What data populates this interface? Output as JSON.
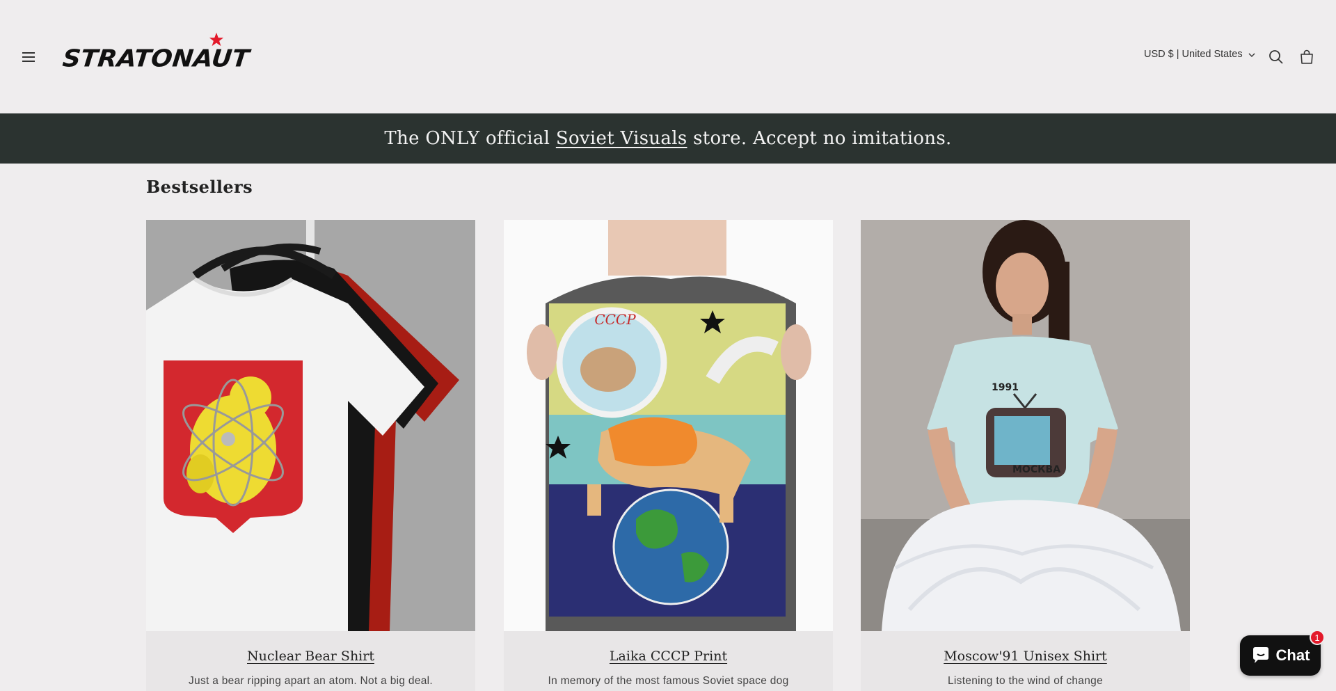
{
  "header": {
    "logo_text": "STRATONAUT",
    "currency": "USD $ | United States"
  },
  "announcement": {
    "prefix": "The ONLY official ",
    "link": "Soviet Visuals",
    "suffix": " store. Accept no imitations."
  },
  "section": {
    "title": "Bestsellers"
  },
  "products": [
    {
      "title": "Nuclear Bear Shirt",
      "description": "Just a bear ripping apart an atom. Not a big deal."
    },
    {
      "title": "Laika CCCP Print",
      "description": "In memory of the most famous Soviet space dog"
    },
    {
      "title": "Moscow'91 Unisex Shirt",
      "description": "Listening to the wind of change"
    }
  ],
  "poster_text": {
    "helmet": "CCCP",
    "tv_year": "1991",
    "tv_city": "МОСКВА"
  },
  "chat": {
    "label": "Chat",
    "badge": "1"
  },
  "colors": {
    "background": "#efedee",
    "announcement_bg": "#2b3330",
    "card_bg": "#e8e6e7",
    "badge": "#e3192a",
    "logo_star": "#e3192a"
  }
}
